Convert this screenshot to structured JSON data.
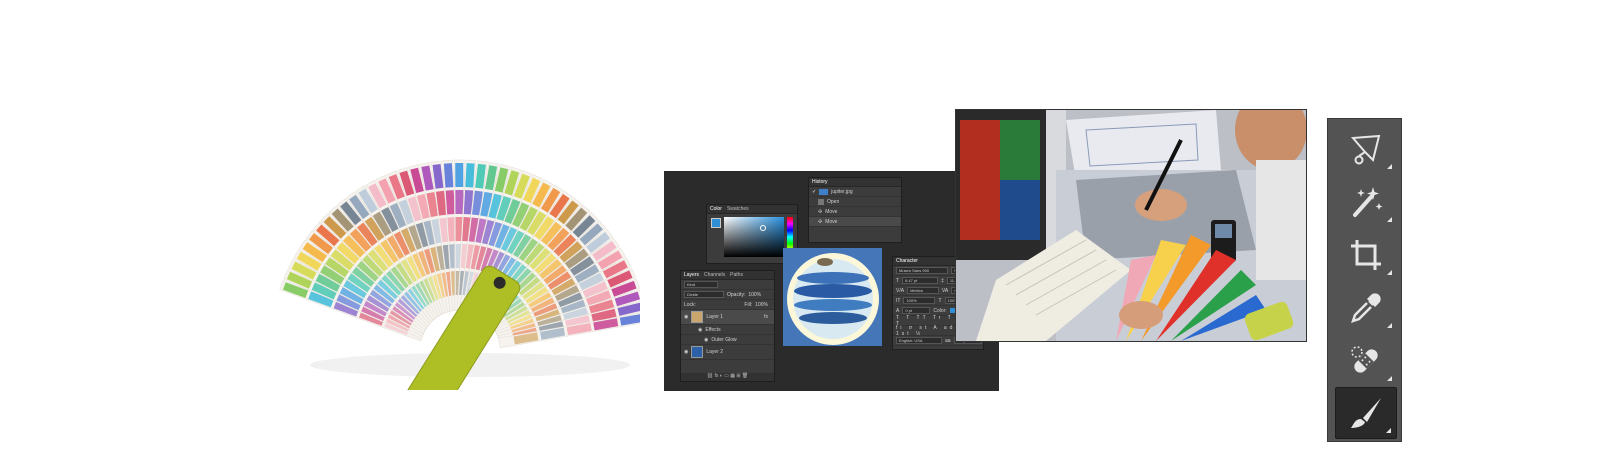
{
  "colors": {
    "toolbar_bg": "#535353",
    "tool_active_bg": "#2a2a2a",
    "ps_bg": "#2b2b2b",
    "fan_tab": "#aebf25"
  },
  "ps": {
    "color_panel": {
      "tabs": [
        "Color",
        "Swatches"
      ]
    },
    "history_panel": {
      "title": "History",
      "items": [
        "jupiter.jpg",
        "Open",
        "Move",
        "Move"
      ]
    },
    "layers_panel": {
      "tabs": [
        "Layers",
        "Channels",
        "Paths"
      ],
      "kind": "Kind",
      "blend": "Divide",
      "opacity_label": "Opacity:",
      "opacity": "100%",
      "lock_label": "Lock:",
      "fill_label": "Fill:",
      "fill": "100%",
      "layers": [
        "Layer 1",
        "Effects",
        "Outer Glow",
        "Layer 2"
      ]
    },
    "character_panel": {
      "title": "Character",
      "font": "Museo Sans 900",
      "style": "900",
      "size": "6.47 pt",
      "leading": "11.77 pt",
      "kerning": "Metrics",
      "tracking": "0",
      "vscale": "100%",
      "hscale": "100%",
      "baseline": "0 pt",
      "color_label": "Color:",
      "language": "English: USA",
      "aa": "Crisp"
    }
  },
  "toolbar": {
    "tools": [
      {
        "icon": "select-and-mask-icon"
      },
      {
        "icon": "magic-wand-icon"
      },
      {
        "icon": "crop-icon"
      },
      {
        "icon": "eyedropper-icon"
      },
      {
        "icon": "spot-healing-icon"
      },
      {
        "icon": "brush-icon",
        "active": true
      }
    ]
  }
}
